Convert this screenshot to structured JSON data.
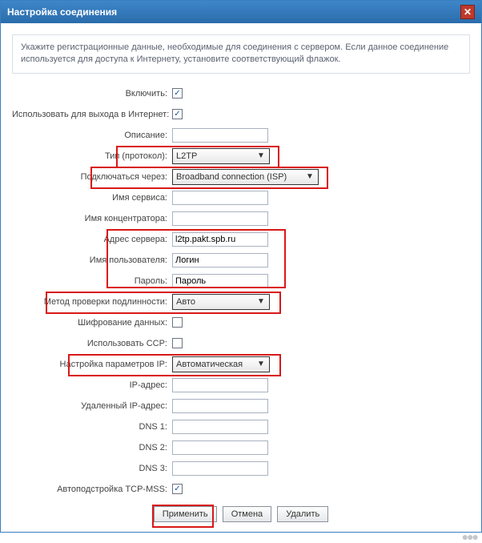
{
  "title": "Настройка соединения",
  "instruction": "Укажите регистрационные данные, необходимые для соединения с сервером. Если данное соединение используется для доступа к Интернету, установите соответствующий флажок.",
  "labels": {
    "enable": "Включить:",
    "use_for_internet": "Использовать для выхода в Интернет:",
    "description": "Описание:",
    "protocol": "Тип (протокол):",
    "connect_via": "Подключаться через:",
    "service_name": "Имя сервиса:",
    "concentrator": "Имя концентратора:",
    "server_addr": "Адрес сервера:",
    "username": "Имя пользователя:",
    "password": "Пароль:",
    "auth_method": "Метод проверки подлинности:",
    "encryption": "Шифрование данных:",
    "use_ccp": "Использовать CCP:",
    "ip_config": "Настройка параметров IP:",
    "ip_addr": "IP-адрес:",
    "remote_ip": "Удаленный IP-адрес:",
    "dns1": "DNS 1:",
    "dns2": "DNS 2:",
    "dns3": "DNS 3:",
    "tcp_mss": "Автоподстройка TCP-MSS:"
  },
  "values": {
    "enable": "✓",
    "use_for_internet": "✓",
    "description": "",
    "protocol": "L2TP",
    "connect_via": "Broadband connection (ISP)",
    "service_name": "",
    "concentrator": "",
    "server_addr": "l2tp.pakt.spb.ru",
    "username": "Логин",
    "password": "Пароль",
    "auth_method": "Авто",
    "encryption": "",
    "use_ccp": "",
    "ip_config": "Автоматическая",
    "ip_addr": "",
    "remote_ip": "",
    "dns1": "",
    "dns2": "",
    "dns3": "",
    "tcp_mss": "✓"
  },
  "buttons": {
    "apply": "Применить",
    "cancel": "Отмена",
    "delete": "Удалить"
  },
  "icons": {
    "close": "✕",
    "dropdown": "▼"
  }
}
